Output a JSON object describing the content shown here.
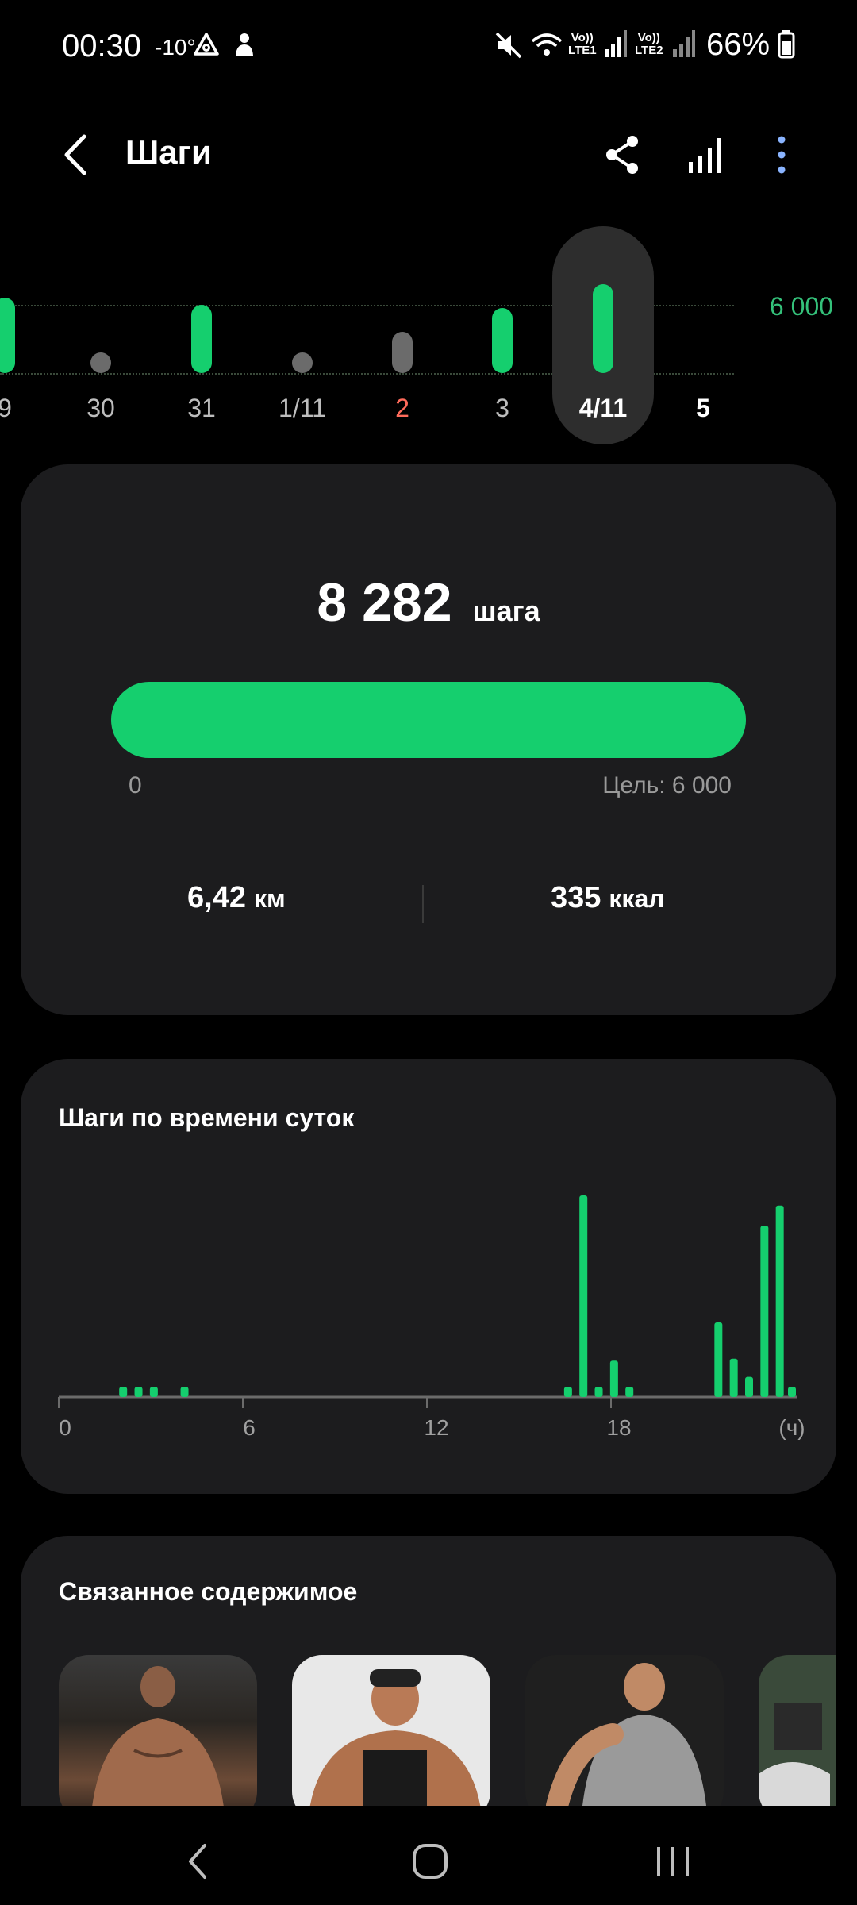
{
  "status_bar": {
    "time": "00:30",
    "temperature": "-10°",
    "sim1": "LTE1",
    "sim2": "LTE2",
    "battery": "66%"
  },
  "header": {
    "title": "Шаги",
    "icons": [
      "back-icon",
      "share-icon",
      "chart-icon",
      "more-icon"
    ]
  },
  "day_selector": {
    "goal_label": "6 000",
    "days": [
      {
        "label": "9",
        "steps_level": 1.1,
        "state": "met"
      },
      {
        "label": "30",
        "steps_level": 0.05,
        "state": "low"
      },
      {
        "label": "31",
        "steps_level": 1.0,
        "state": "met"
      },
      {
        "label": "1/11",
        "steps_level": 0.08,
        "state": "low"
      },
      {
        "label": "2",
        "steps_level": 0.6,
        "state": "low"
      },
      {
        "label": "3",
        "steps_level": 0.95,
        "state": "met"
      },
      {
        "label": "4/11",
        "steps_level": 1.3,
        "state": "selected"
      },
      {
        "label": "5",
        "steps_level": 0,
        "state": "future"
      }
    ]
  },
  "summary": {
    "steps": "8 282",
    "steps_unit": "шага",
    "progress_fraction": 1.0,
    "progress_min": "0",
    "goal_text": "Цель: 6 000",
    "distance_value": "6,42",
    "distance_unit": "км",
    "calories_value": "335",
    "calories_unit": "ккал"
  },
  "hourly": {
    "title": "Шаги по времени суток",
    "axis_ticks": [
      "0",
      "6",
      "12",
      "18",
      "(ч)"
    ]
  },
  "chart_data": {
    "type": "bar",
    "title": "Шаги по времени суток",
    "xlabel": "(ч)",
    "x_ticks": [
      0,
      6,
      12,
      18
    ],
    "xlim": [
      0,
      24
    ],
    "bars": [
      {
        "hour": 2.1,
        "value": 0.05
      },
      {
        "hour": 2.6,
        "value": 0.05
      },
      {
        "hour": 3.1,
        "value": 0.05
      },
      {
        "hour": 4.1,
        "value": 0.05
      },
      {
        "hour": 16.6,
        "value": 0.05
      },
      {
        "hour": 17.1,
        "value": 1.0
      },
      {
        "hour": 17.6,
        "value": 0.05
      },
      {
        "hour": 18.1,
        "value": 0.18
      },
      {
        "hour": 18.6,
        "value": 0.05
      },
      {
        "hour": 21.5,
        "value": 0.37
      },
      {
        "hour": 22.0,
        "value": 0.19
      },
      {
        "hour": 22.5,
        "value": 0.1
      },
      {
        "hour": 23.0,
        "value": 0.85
      },
      {
        "hour": 23.5,
        "value": 0.95
      },
      {
        "hour": 24.0,
        "value": 0.05
      }
    ]
  },
  "related": {
    "title": "Связанное содержимое"
  },
  "colors": {
    "accent": "#15cf6e",
    "muted_bar": "#6b6b6b",
    "card": "#1c1c1e",
    "weekend": "#ff6b5b"
  }
}
